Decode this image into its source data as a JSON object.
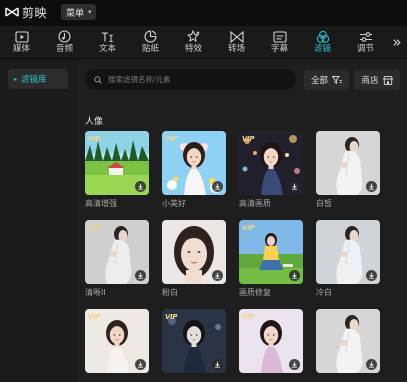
{
  "app": {
    "name": "剪映",
    "menu_label": "菜单"
  },
  "tools": [
    {
      "key": "media",
      "label": "媒体",
      "icon": "media-icon",
      "active": false
    },
    {
      "key": "audio",
      "label": "音频",
      "icon": "audio-icon",
      "active": false
    },
    {
      "key": "text",
      "label": "文本",
      "icon": "text-icon",
      "active": false
    },
    {
      "key": "sticker",
      "label": "贴纸",
      "icon": "sticker-icon",
      "active": false
    },
    {
      "key": "effects",
      "label": "特效",
      "icon": "effects-icon",
      "active": false
    },
    {
      "key": "transition",
      "label": "转场",
      "icon": "transition-icon",
      "active": false
    },
    {
      "key": "captions",
      "label": "字幕",
      "icon": "captions-icon",
      "active": false
    },
    {
      "key": "filters",
      "label": "滤镜",
      "icon": "filters-icon",
      "active": true
    },
    {
      "key": "adjust",
      "label": "调节",
      "icon": "adjust-icon",
      "active": false
    }
  ],
  "sidebar": {
    "items": [
      {
        "label": "滤镜库",
        "active": true
      }
    ]
  },
  "search": {
    "placeholder": "搜索滤镜名称/元素"
  },
  "buttons": {
    "all_label": "全部",
    "store_label": "商店"
  },
  "section": {
    "title": "人像"
  },
  "filters": [
    {
      "name": "高清增强",
      "vip": true,
      "scene": "landscape"
    },
    {
      "name": "小美好",
      "vip": true,
      "scene": "girl-sky"
    },
    {
      "name": "高清画质",
      "vip": true,
      "scene": "night-lights"
    },
    {
      "name": "白皙",
      "vip": false,
      "scene": "white-dress"
    },
    {
      "name": "清晰II",
      "vip": true,
      "scene": "white-dress-grey"
    },
    {
      "name": "粉白",
      "vip": false,
      "scene": "portrait-close"
    },
    {
      "name": "画质修复",
      "vip": true,
      "scene": "meadow"
    },
    {
      "name": "冷白",
      "vip": false,
      "scene": "white-dress-cool"
    },
    {
      "name": "",
      "vip": true,
      "scene": "portrait-soft"
    },
    {
      "name": "",
      "vip": true,
      "scene": "portrait-dark"
    },
    {
      "name": "",
      "vip": true,
      "scene": "portrait-light"
    },
    {
      "name": "",
      "vip": false,
      "scene": "white-dress"
    }
  ],
  "colors": {
    "accent": "#25c3d3",
    "vip_gold": "#f1d38a",
    "panel": "#1e1e1e"
  }
}
